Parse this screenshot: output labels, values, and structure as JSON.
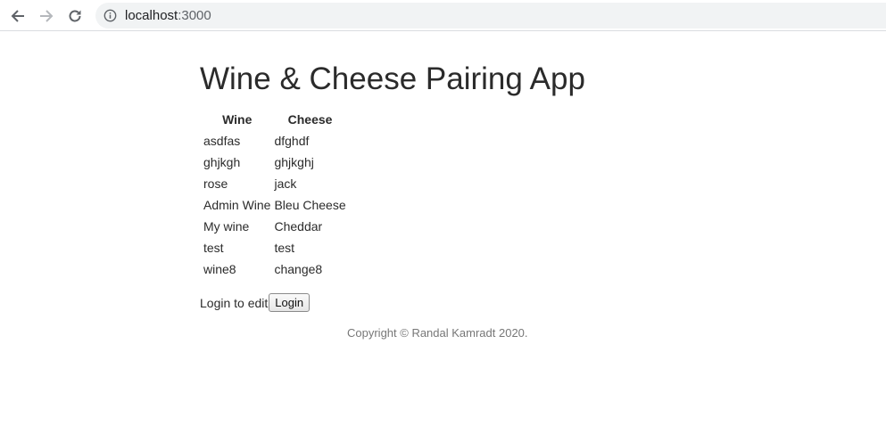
{
  "browser": {
    "url_host": "localhost",
    "url_port": ":3000",
    "back_icon": "arrow-left-icon",
    "forward_icon": "arrow-right-icon",
    "reload_icon": "reload-icon",
    "info_icon": "info-circle-icon"
  },
  "page": {
    "title": "Wine & Cheese Pairing App",
    "table": {
      "headers": [
        "Wine",
        "Cheese"
      ],
      "rows": [
        [
          "asdfas",
          "dfghdf"
        ],
        [
          "ghjkgh",
          "ghjkghj"
        ],
        [
          "rose",
          "jack"
        ],
        [
          "Admin Wine",
          "Bleu Cheese"
        ],
        [
          "My wine",
          "Cheddar"
        ],
        [
          "test",
          "test"
        ],
        [
          "wine8",
          "change8"
        ]
      ]
    },
    "login_prompt": "Login to edit",
    "login_button": "Login",
    "footer": "Copyright © Randal Kamradt 2020."
  }
}
